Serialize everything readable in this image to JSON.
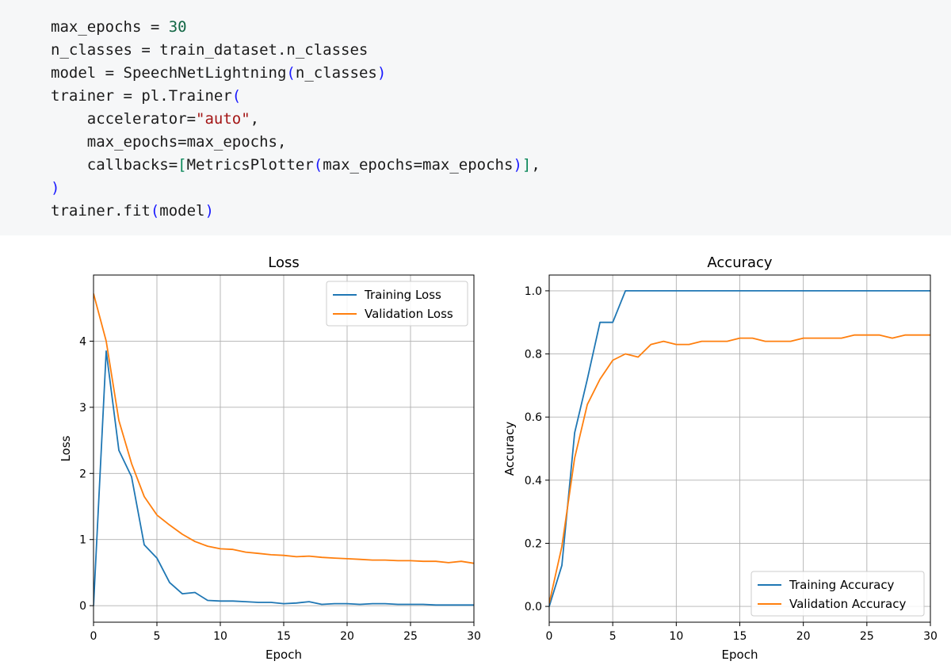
{
  "code": {
    "lines": [
      [
        {
          "t": "max_epochs = "
        },
        {
          "t": "30",
          "c": "tk-num"
        }
      ],
      [
        {
          "t": "n_classes = train_dataset.n_classes"
        }
      ],
      [
        {
          "t": "model = SpeechNetLightning"
        },
        {
          "t": "(",
          "c": "tk-paren"
        },
        {
          "t": "n_classes"
        },
        {
          "t": ")",
          "c": "tk-paren"
        }
      ],
      [
        {
          "t": "trainer = pl.Trainer"
        },
        {
          "t": "(",
          "c": "tk-paren"
        }
      ],
      [
        {
          "t": "    accelerator="
        },
        {
          "t": "\"auto\"",
          "c": "tk-str"
        },
        {
          "t": ","
        }
      ],
      [
        {
          "t": "    max_epochs=max_epochs,"
        }
      ],
      [
        {
          "t": "    callbacks="
        },
        {
          "t": "[",
          "c": "tk-brack"
        },
        {
          "t": "MetricsPlotter"
        },
        {
          "t": "(",
          "c": "tk-paren"
        },
        {
          "t": "max_epochs=max_epochs"
        },
        {
          "t": ")",
          "c": "tk-paren"
        },
        {
          "t": "]",
          "c": "tk-brack"
        },
        {
          "t": ","
        }
      ],
      [
        {
          "t": ")",
          "c": "tk-paren"
        }
      ],
      [
        {
          "t": "trainer.fit"
        },
        {
          "t": "(",
          "c": "tk-paren"
        },
        {
          "t": "model"
        },
        {
          "t": ")",
          "c": "tk-paren"
        }
      ]
    ]
  },
  "colors": {
    "training": "#1f77b4",
    "validation": "#ff7f0e",
    "grid": "#b0b0b0"
  },
  "chart_data": [
    {
      "type": "line",
      "title": "Loss",
      "xlabel": "Epoch",
      "ylabel": "Loss",
      "xlim": [
        0,
        30
      ],
      "ylim": [
        -0.25,
        5.0
      ],
      "xticks": [
        0,
        5,
        10,
        15,
        20,
        25,
        30
      ],
      "yticks": [
        0,
        1,
        2,
        3,
        4
      ],
      "grid": true,
      "legend": "top-right",
      "series": [
        {
          "name": "Training Loss",
          "color": "#1f77b4",
          "x": [
            0,
            1,
            2,
            3,
            4,
            5,
            6,
            7,
            8,
            9,
            10,
            11,
            12,
            13,
            14,
            15,
            16,
            17,
            18,
            19,
            20,
            21,
            22,
            23,
            24,
            25,
            26,
            27,
            28,
            29,
            30
          ],
          "y": [
            0.0,
            3.85,
            2.35,
            1.95,
            0.92,
            0.72,
            0.35,
            0.18,
            0.2,
            0.08,
            0.07,
            0.07,
            0.06,
            0.05,
            0.05,
            0.03,
            0.04,
            0.06,
            0.02,
            0.03,
            0.03,
            0.02,
            0.03,
            0.03,
            0.02,
            0.02,
            0.02,
            0.01,
            0.01,
            0.01,
            0.01
          ]
        },
        {
          "name": "Validation Loss",
          "color": "#ff7f0e",
          "x": [
            0,
            1,
            2,
            3,
            4,
            5,
            6,
            7,
            8,
            9,
            10,
            11,
            12,
            13,
            14,
            15,
            16,
            17,
            18,
            19,
            20,
            21,
            22,
            23,
            24,
            25,
            26,
            27,
            28,
            29,
            30
          ],
          "y": [
            4.72,
            4.0,
            2.8,
            2.15,
            1.65,
            1.37,
            1.22,
            1.08,
            0.97,
            0.9,
            0.86,
            0.85,
            0.81,
            0.79,
            0.77,
            0.76,
            0.74,
            0.75,
            0.73,
            0.72,
            0.71,
            0.7,
            0.69,
            0.69,
            0.68,
            0.68,
            0.67,
            0.67,
            0.65,
            0.67,
            0.64
          ]
        }
      ]
    },
    {
      "type": "line",
      "title": "Accuracy",
      "xlabel": "Epoch",
      "ylabel": "Accuracy",
      "xlim": [
        0,
        30
      ],
      "ylim": [
        -0.05,
        1.05
      ],
      "xticks": [
        0,
        5,
        10,
        15,
        20,
        25,
        30
      ],
      "yticks": [
        0.0,
        0.2,
        0.4,
        0.6,
        0.8,
        1.0
      ],
      "grid": true,
      "legend": "bottom-right",
      "series": [
        {
          "name": "Training Accuracy",
          "color": "#1f77b4",
          "x": [
            0,
            1,
            2,
            3,
            4,
            5,
            6,
            7,
            8,
            9,
            10,
            11,
            12,
            13,
            14,
            15,
            16,
            17,
            18,
            19,
            20,
            21,
            22,
            23,
            24,
            25,
            26,
            27,
            28,
            29,
            30
          ],
          "y": [
            0.0,
            0.13,
            0.55,
            0.72,
            0.9,
            0.9,
            1.0,
            1.0,
            1.0,
            1.0,
            1.0,
            1.0,
            1.0,
            1.0,
            1.0,
            1.0,
            1.0,
            1.0,
            1.0,
            1.0,
            1.0,
            1.0,
            1.0,
            1.0,
            1.0,
            1.0,
            1.0,
            1.0,
            1.0,
            1.0,
            1.0
          ]
        },
        {
          "name": "Validation Accuracy",
          "color": "#ff7f0e",
          "x": [
            0,
            1,
            2,
            3,
            4,
            5,
            6,
            7,
            8,
            9,
            10,
            11,
            12,
            13,
            14,
            15,
            16,
            17,
            18,
            19,
            20,
            21,
            22,
            23,
            24,
            25,
            26,
            27,
            28,
            29,
            30
          ],
          "y": [
            0.01,
            0.19,
            0.47,
            0.64,
            0.72,
            0.78,
            0.8,
            0.79,
            0.83,
            0.84,
            0.83,
            0.83,
            0.84,
            0.84,
            0.84,
            0.85,
            0.85,
            0.84,
            0.84,
            0.84,
            0.85,
            0.85,
            0.85,
            0.85,
            0.86,
            0.86,
            0.86,
            0.85,
            0.86,
            0.86,
            0.86
          ]
        }
      ]
    }
  ]
}
